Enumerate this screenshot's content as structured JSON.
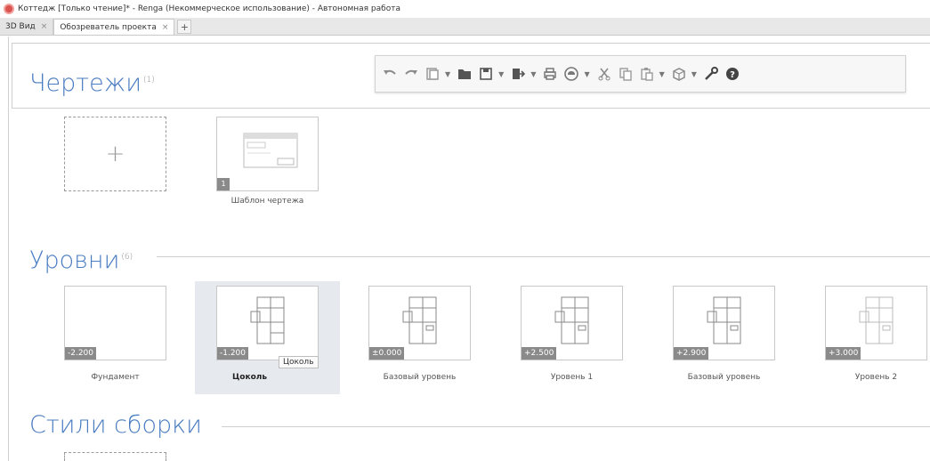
{
  "window": {
    "title": "Коттедж [Только чтение]* - Renga (Некоммерческое использование) - Автономная работа"
  },
  "tabs": [
    {
      "label": "3D Вид",
      "close": "×"
    },
    {
      "label": "Обозреватель проекта",
      "close": "×"
    }
  ],
  "tab_add_label": "+",
  "sections": {
    "drawings": {
      "title": "Чертежи",
      "count": "(1)"
    },
    "levels": {
      "title": "Уровни",
      "count": "(6)"
    },
    "assembly_styles": {
      "title": "Стили сборки"
    }
  },
  "drawings": {
    "add_label": "+",
    "items": [
      {
        "label": "Шаблон чертежа",
        "badge": "1"
      }
    ]
  },
  "levels": [
    {
      "label": "Фундамент",
      "elevation": "-2.200"
    },
    {
      "label": "Цоколь",
      "elevation": "-1.200"
    },
    {
      "label": "Базовый уровень",
      "elevation": "±0.000"
    },
    {
      "label": "Уровень 1",
      "elevation": "+2.500"
    },
    {
      "label": "Базовый уровень",
      "elevation": "+2.900"
    },
    {
      "label": "Уровень 2",
      "elevation": "+3.000"
    }
  ],
  "tooltip": "Цоколь",
  "toolbar": {
    "icons": [
      "undo-icon",
      "redo-icon",
      "properties-icon",
      "folder-icon",
      "save-icon",
      "export-icon",
      "print-icon",
      "cloud-icon",
      "cut-icon",
      "copy-icon",
      "paste-icon",
      "view-cube-icon",
      "settings-wrench-icon",
      "help-icon"
    ]
  },
  "colors": {
    "section_title": "#4a7cc2",
    "selection_bg": "#e6e9ee",
    "badge": "#8a8a8a"
  }
}
